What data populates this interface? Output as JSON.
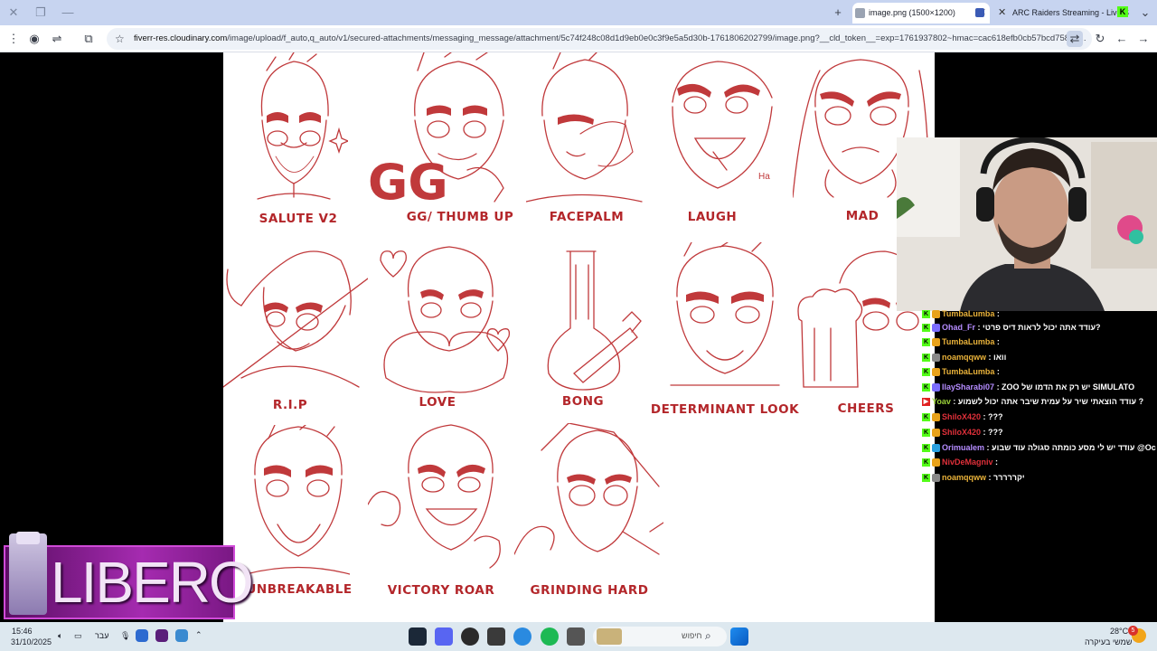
{
  "browser": {
    "tabs": [
      {
        "title": "image.png (1500×1200)",
        "active": true
      },
      {
        "title": "ARC Raiders Streaming - Live S",
        "active": false
      }
    ],
    "url_domain": "fiverr-res.cloudinary.com",
    "url_path": "/image/upload/f_auto,q_auto/v1/secured-attachments/messaging_message/attachment/5c74f248c08d1d9eb0e0c3f9e5a5d30b-1761806202799/image.png?__cld_token__=exp=1761937802~hmac=cac618efb0cb57bcd758d3..."
  },
  "emotes": [
    {
      "label": "SALUTE V2"
    },
    {
      "label": "GG/ THUMB UP",
      "overlay_text": "GG"
    },
    {
      "label": "FACEPALM"
    },
    {
      "label": "LAUGH"
    },
    {
      "label": "MAD"
    },
    {
      "label": "R.I.P"
    },
    {
      "label": "LOVE"
    },
    {
      "label": "BONG"
    },
    {
      "label": "DETERMINANT LOOK"
    },
    {
      "label": "CHEERS"
    },
    {
      "label": "UNBREAKABLE"
    },
    {
      "label": "VICTORY ROAR"
    },
    {
      "label": "GRINDING HARD"
    }
  ],
  "chat": [
    {
      "user": "TumbaLumba",
      "text": ":",
      "color": "#e9b23a"
    },
    {
      "user": "Ohad_Fr",
      "text": ": עודד אתה יכול לראות דיס פרטי?",
      "color": "#b58cff"
    },
    {
      "user": "TumbaLumba",
      "text": ":",
      "color": "#e9b23a"
    },
    {
      "user": "noamqqww",
      "text": ": וואו",
      "color": "#e9b23a"
    },
    {
      "user": "TumbaLumba",
      "text": ":",
      "color": "#e9b23a"
    },
    {
      "user": "IlaySharabi07",
      "text": ": ZOO יש רק את הדמו של SIMULATO",
      "color": "#b58cff"
    },
    {
      "user": "Yoav",
      "text": ": עודד הוצאתי שיר על עמית שיבר אתה יכול לשמוע ?",
      "color": "#9bd13a"
    },
    {
      "user": "ShiloX420",
      "text": ": ???",
      "color": "#e0303a"
    },
    {
      "user": "ShiloX420",
      "text": ": ???",
      "color": "#e0303a"
    },
    {
      "user": "Orimualem",
      "text": ": עודד יש לי מסע כומתה סגולה עוד שבוע @Oc",
      "color": "#b58cff"
    },
    {
      "user": "NivDeMagniv",
      "text": ":",
      "color": "#e0303a"
    },
    {
      "user": "noamqqww",
      "text": ": יקררררר",
      "color": "#e9b23a"
    }
  ],
  "sponsor": {
    "brand": "LIBERO"
  },
  "taskbar": {
    "time": "15:46",
    "date": "31/10/2025",
    "lang": "עבר",
    "search_placeholder": "חיפוש",
    "temperature": "28°C",
    "weather": "שמשי בעיקרה",
    "notif_count": "5"
  },
  "colors": {
    "sketch_red": "#c0393b",
    "tabbar": "#c7d4f0",
    "kick_green": "#53fc18",
    "sponsor_purple": "#9a1ea0"
  }
}
